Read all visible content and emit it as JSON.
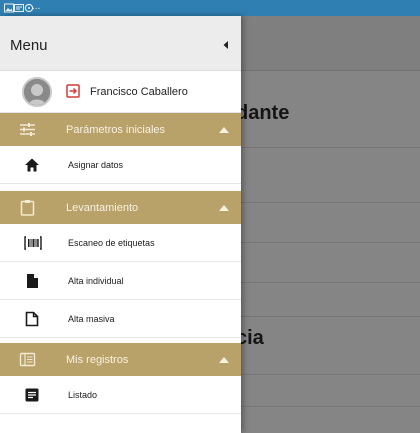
{
  "status_bar": {
    "overflow_indicator": "...",
    "icons": [
      "gallery-icon",
      "card-icon",
      "sync-icon"
    ]
  },
  "background": {
    "title_fragment_1": "dante",
    "title_fragment_2": "cia"
  },
  "drawer": {
    "title": "Menu",
    "user": {
      "name": "Francisco Caballero",
      "icon": "logout-icon"
    },
    "sections": [
      {
        "label": "Parámetros iniciales",
        "icon": "sliders-icon",
        "items": [
          {
            "label": "Asignar datos",
            "icon": "home-icon"
          }
        ]
      },
      {
        "label": "Levantamiento",
        "icon": "clipboard-icon",
        "items": [
          {
            "label": "Escaneo de etiquetas",
            "icon": "barcode-icon"
          },
          {
            "label": "Alta individual",
            "icon": "file-icon"
          },
          {
            "label": "Alta masiva",
            "icon": "files-icon"
          }
        ]
      },
      {
        "label": "Mis registros",
        "icon": "records-icon",
        "items": [
          {
            "label": "Listado",
            "icon": "list-icon"
          }
        ]
      }
    ]
  },
  "colors": {
    "status_bar": "#2f7fb2",
    "section_header": "#b9a26a",
    "logout_icon": "#d23a3a",
    "scrim": "#858585"
  }
}
